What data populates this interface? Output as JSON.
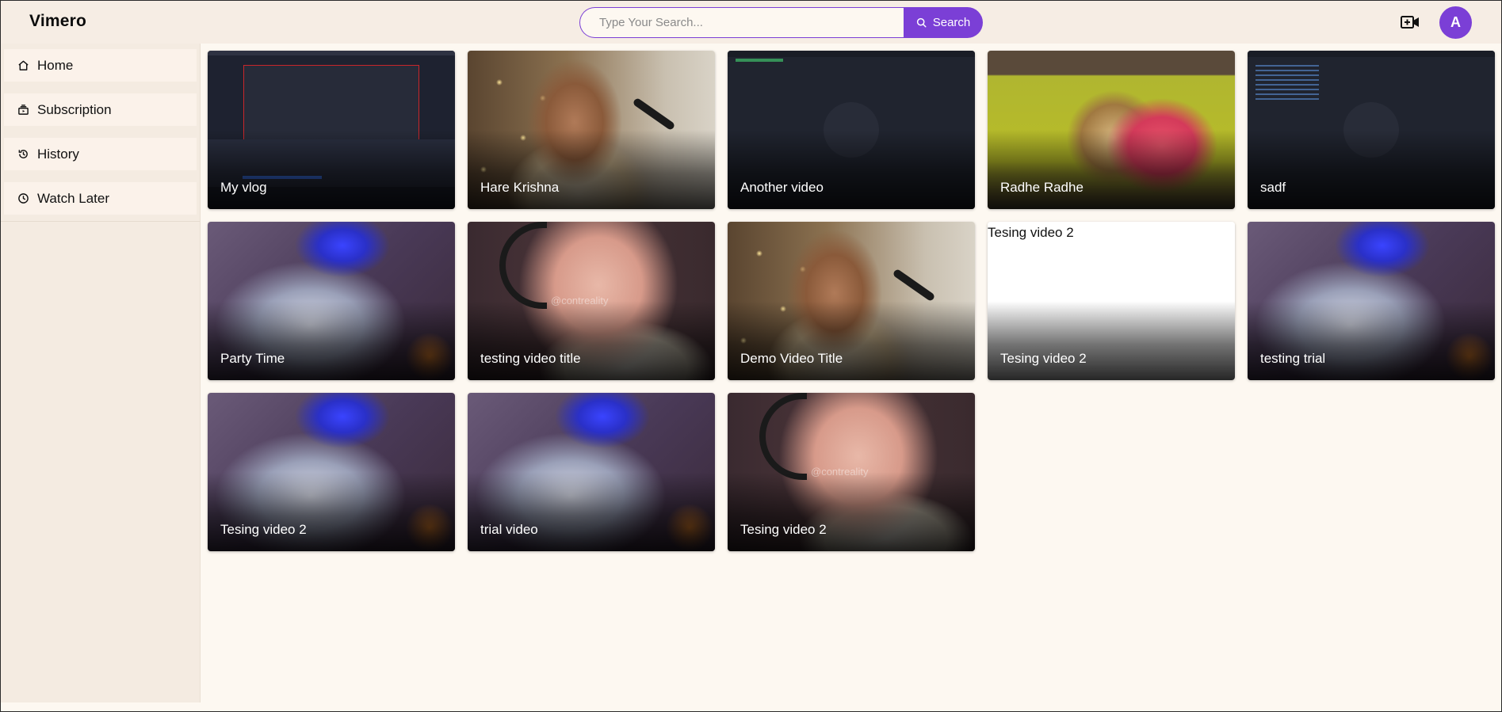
{
  "app": {
    "title": "Vimero",
    "avatar_initial": "A"
  },
  "search": {
    "placeholder": "Type Your Search...",
    "button_label": "Search"
  },
  "sidebar": {
    "items": [
      {
        "label": "Home",
        "icon": "home-icon"
      },
      {
        "label": "Subscription",
        "icon": "subscription-icon"
      },
      {
        "label": "History",
        "icon": "history-icon"
      },
      {
        "label": "Watch Later",
        "icon": "clock-icon"
      }
    ]
  },
  "videos": [
    {
      "title": "My vlog"
    },
    {
      "title": "Hare Krishna"
    },
    {
      "title": "Another video"
    },
    {
      "title": "Radhe Radhe"
    },
    {
      "title": "sadf"
    },
    {
      "title": "Party Time"
    },
    {
      "title": "testing video title"
    },
    {
      "title": "Demo Video Title"
    },
    {
      "title": "Tesing video 2",
      "thumbnail_alt": "Tesing video 2"
    },
    {
      "title": "testing trial"
    },
    {
      "title": "Tesing video 2"
    },
    {
      "title": "trial video"
    },
    {
      "title": "Tesing video 2"
    }
  ],
  "watermark": "@contreality",
  "colors": {
    "accent": "#7b3fd6",
    "header_bg": "#f6ede4",
    "page_bg": "#fdf8f1",
    "sidebar_bg": "#f4ebe1"
  }
}
